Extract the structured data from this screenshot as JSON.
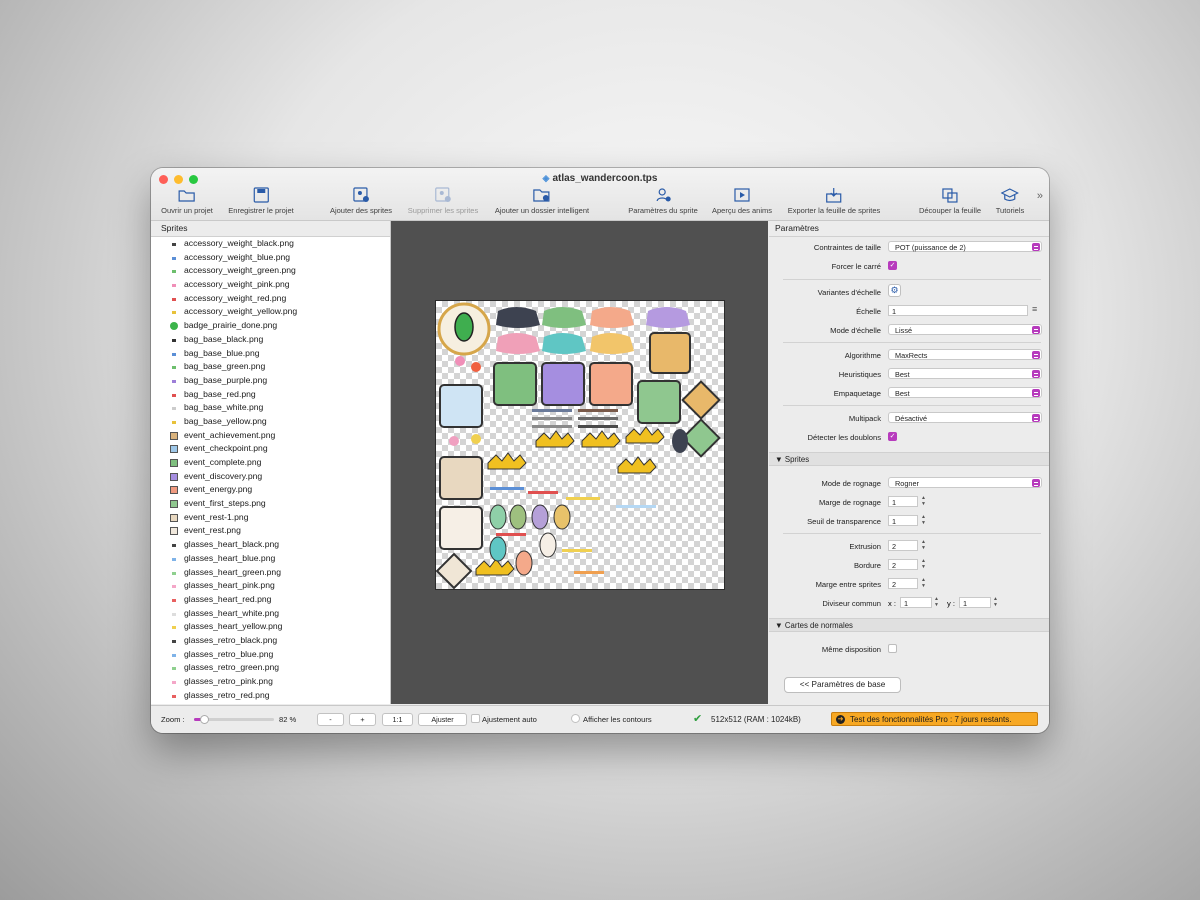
{
  "window": {
    "title": "atlas_wandercoon.tps"
  },
  "toolbar": {
    "open": "Ouvrir un projet",
    "save": "Enregistrer le projet",
    "add_sprites": "Ajouter des sprites",
    "remove_sprites": "Supprimer les sprites",
    "add_smart_folder": "Ajouter un dossier intelligent",
    "sprite_settings": "Paramètres du sprite",
    "anim_preview": "Aperçu des anims",
    "export": "Exporter la feuille de sprites",
    "split_sheet": "Découper la feuille",
    "tutorials": "Tutoriels"
  },
  "sprites_panel": {
    "header": "Sprites",
    "items": [
      "accessory_weight_black.png",
      "accessory_weight_blue.png",
      "accessory_weight_green.png",
      "accessory_weight_pink.png",
      "accessory_weight_red.png",
      "accessory_weight_yellow.png",
      "badge_prairie_done.png",
      "bag_base_black.png",
      "bag_base_blue.png",
      "bag_base_green.png",
      "bag_base_purple.png",
      "bag_base_red.png",
      "bag_base_white.png",
      "bag_base_yellow.png",
      "event_achievement.png",
      "event_checkpoint.png",
      "event_complete.png",
      "event_discovery.png",
      "event_energy.png",
      "event_first_steps.png",
      "event_rest-1.png",
      "event_rest.png",
      "glasses_heart_black.png",
      "glasses_heart_blue.png",
      "glasses_heart_green.png",
      "glasses_heart_pink.png",
      "glasses_heart_red.png",
      "glasses_heart_white.png",
      "glasses_heart_yellow.png",
      "glasses_retro_black.png",
      "glasses_retro_blue.png",
      "glasses_retro_green.png",
      "glasses_retro_pink.png",
      "glasses_retro_red.png"
    ],
    "icon_colors": [
      "#444",
      "#5b8fd6",
      "#6dbf6d",
      "#f08fb8",
      "#e05050",
      "#e8c23a",
      "#3cb44b",
      "#333",
      "#5b8fd6",
      "#6dbf6d",
      "#9d7ed8",
      "#e05050",
      "#ccc",
      "#e8c23a",
      "#d9b27c",
      "#9ec7e8",
      "#7fbf7f",
      "#a58ee0",
      "#f09a80",
      "#8fc78f",
      "#e8d8c0",
      "#f0e8dc",
      "#444",
      "#7fb3e8",
      "#8fd08f",
      "#f4a7c8",
      "#e86060",
      "#ddd",
      "#f0d050",
      "#444",
      "#7fb3e8",
      "#8fd08f",
      "#f4a7c8",
      "#e86060"
    ]
  },
  "settings_panel": {
    "header": "Paramètres",
    "size_constraints_label": "Contraintes de taille",
    "size_constraints_value": "POT (puissance de 2)",
    "force_square_label": "Forcer le carré",
    "scale_variants_label": "Variantes d'échelle",
    "scale_label": "Échelle",
    "scale_value": "1",
    "scale_mode_label": "Mode d'échelle",
    "scale_mode_value": "Lissé",
    "algorithm_label": "Algorithme",
    "algorithm_value": "MaxRects",
    "heuristics_label": "Heuristiques",
    "heuristics_value": "Best",
    "packing_label": "Empaquetage",
    "packing_value": "Best",
    "multipack_label": "Multipack",
    "multipack_value": "Désactivé",
    "detect_dupes_label": "Détecter les doublons",
    "sprites_section": "Sprites",
    "trim_mode_label": "Mode de rognage",
    "trim_mode_value": "Rogner",
    "trim_margin_label": "Marge de rognage",
    "trim_margin_value": "1",
    "alpha_threshold_label": "Seuil de transparence",
    "alpha_threshold_value": "1",
    "extrude_label": "Extrusion",
    "extrude_value": "2",
    "border_label": "Bordure",
    "border_value": "2",
    "shape_padding_label": "Marge entre sprites",
    "shape_padding_value": "2",
    "common_divisor_label": "Diviseur commun",
    "divisor_x_label": "x :",
    "divisor_x_value": "1",
    "divisor_y_label": "y :",
    "divisor_y_value": "1",
    "normal_maps_section": "Cartes de normales",
    "same_layout_label": "Même disposition",
    "basic_settings_button": "<< Paramètres de base"
  },
  "status": {
    "zoom_label": "Zoom :",
    "zoom_value": "82 %",
    "zoom_fraction": 0.12,
    "minus": "-",
    "plus": "+",
    "one_to_one": "1:1",
    "fit": "Ajuster",
    "auto_fit": "Ajustement auto",
    "show_outlines": "Afficher les contours",
    "sheet_info": "512x512 (RAM : 1024kB)",
    "pro_banner": "Test des fonctionnalités Pro : 7 jours restants."
  },
  "colors": {
    "accent": "#b73bbd",
    "pro_banner": "#f7a823"
  }
}
